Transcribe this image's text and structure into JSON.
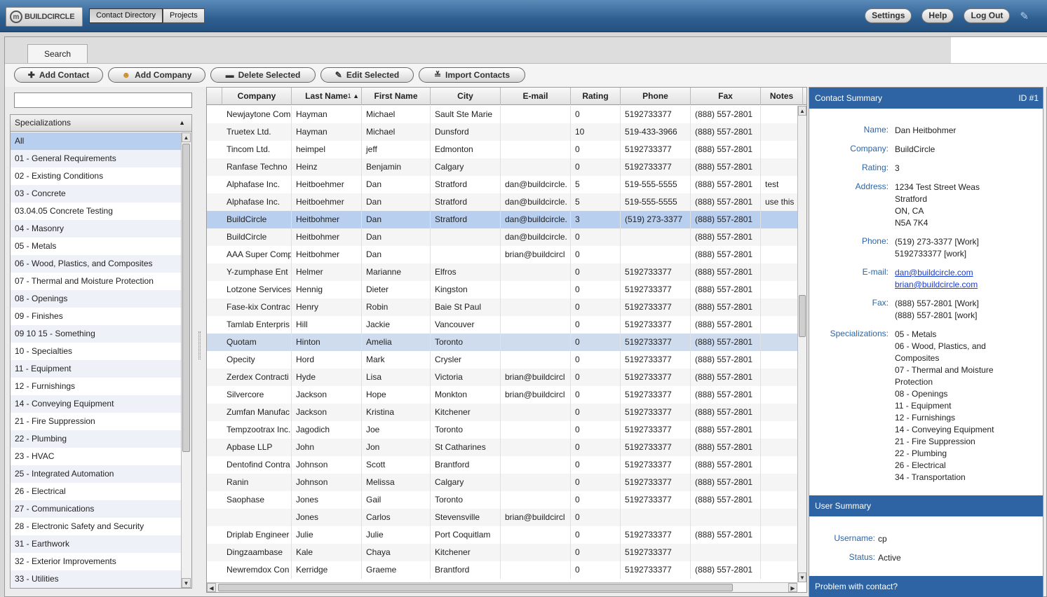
{
  "app": {
    "logo_text": "BUILDCIRCLE"
  },
  "nav": {
    "tabs": [
      "Contact Directory",
      "Projects"
    ],
    "right_buttons": [
      "Settings",
      "Help",
      "Log Out"
    ]
  },
  "search_tab": "Search",
  "toolbar": {
    "add_contact": "Add Contact",
    "add_company": "Add Company",
    "delete_selected": "Delete Selected",
    "edit_selected": "Edit Selected",
    "import_contacts": "Import Contacts"
  },
  "filter": {
    "search_value": "",
    "header": "Specializations",
    "items": [
      "All",
      "01 - General Requirements",
      "02 - Existing Conditions",
      "03 - Concrete",
      "03.04.05 Concrete Testing",
      "04 - Masonry",
      "05 - Metals",
      "06 - Wood, Plastics, and Composites",
      "07 - Thermal and Moisture Protection",
      "08 - Openings",
      "09 - Finishes",
      "09 10 15 - Something",
      "10 - Specialties",
      "11 - Equipment",
      "12 - Furnishings",
      "14 - Conveying Equipment",
      "21 - Fire Suppression",
      "22 - Plumbing",
      "23 - HVAC",
      "25 - Integrated Automation",
      "26 - Electrical",
      "27 - Communications",
      "28 - Electronic Safety and Security",
      "31 - Earthwork",
      "32 - Exterior Improvements",
      "33 - Utilities"
    ],
    "selected_index": 0
  },
  "grid": {
    "columns": [
      "Company",
      "Last Name",
      "First Name",
      "City",
      "E-mail",
      "Rating",
      "Phone",
      "Fax",
      "Notes"
    ],
    "sort_indicator": "1 ▲",
    "selected_row": 6,
    "highlight_row": 13,
    "rows": [
      [
        "Newjaytone Com",
        "Hayman",
        "Michael",
        "Sault Ste Marie",
        "",
        "0",
        "5192733377",
        "(888) 557-2801",
        ""
      ],
      [
        "Truetex Ltd.",
        "Hayman",
        "Michael",
        "Dunsford",
        "",
        "10",
        "519-433-3966",
        "(888) 557-2801",
        ""
      ],
      [
        "Tincom Ltd.",
        "heimpel",
        "jeff",
        "Edmonton",
        "",
        "0",
        "5192733377",
        "(888) 557-2801",
        ""
      ],
      [
        "Ranfase Techno",
        "Heinz",
        "Benjamin",
        "Calgary",
        "",
        "0",
        "5192733377",
        "(888) 557-2801",
        ""
      ],
      [
        "Alphafase Inc.",
        "Heitboehmer",
        "Dan",
        "Stratford",
        "dan@buildcircle.",
        "5",
        "519-555-5555",
        "(888) 557-2801",
        "test"
      ],
      [
        "Alphafase Inc.",
        "Heitboehmer",
        "Dan",
        "Stratford",
        "dan@buildcircle.",
        "5",
        "519-555-5555",
        "(888) 557-2801",
        "use this"
      ],
      [
        "BuildCircle",
        "Heitbohmer",
        "Dan",
        "Stratford",
        "dan@buildcircle.",
        "3",
        "(519) 273-3377",
        "(888) 557-2801",
        ""
      ],
      [
        "BuildCircle",
        "Heitbohmer",
        "Dan",
        "",
        "dan@buildcircle.",
        "0",
        "",
        "(888) 557-2801",
        ""
      ],
      [
        "AAA Super Comp",
        "Heitbohmer",
        "Dan",
        "",
        "brian@buildcircl",
        "0",
        "",
        "(888) 557-2801",
        ""
      ],
      [
        "Y-zumphase Ent",
        "Helmer",
        "Marianne",
        "Elfros",
        "",
        "0",
        "5192733377",
        "(888) 557-2801",
        ""
      ],
      [
        "Lotzone Services",
        "Hennig",
        "Dieter",
        "Kingston",
        "",
        "0",
        "5192733377",
        "(888) 557-2801",
        ""
      ],
      [
        "Fase-kix Contrac",
        "Henry",
        "Robin",
        "Baie St Paul",
        "",
        "0",
        "5192733377",
        "(888) 557-2801",
        ""
      ],
      [
        "Tamlab Enterpris",
        "Hill",
        "Jackie",
        "Vancouver",
        "",
        "0",
        "5192733377",
        "(888) 557-2801",
        ""
      ],
      [
        "Quotam",
        "Hinton",
        "Amelia",
        "Toronto",
        "",
        "0",
        "5192733377",
        "(888) 557-2801",
        ""
      ],
      [
        "Opecity",
        "Hord",
        "Mark",
        "Crysler",
        "",
        "0",
        "5192733377",
        "(888) 557-2801",
        ""
      ],
      [
        "Zerdex Contracti",
        "Hyde",
        "Lisa",
        "Victoria",
        "brian@buildcircl",
        "0",
        "5192733377",
        "(888) 557-2801",
        ""
      ],
      [
        "Silvercore",
        "Jackson",
        "Hope",
        "Monkton",
        "brian@buildcircl",
        "0",
        "5192733377",
        "(888) 557-2801",
        ""
      ],
      [
        "Zumfan Manufac",
        "Jackson",
        "Kristina",
        "Kitchener",
        "",
        "0",
        "5192733377",
        "(888) 557-2801",
        ""
      ],
      [
        "Tempzootrax Inc.",
        "Jagodich",
        "Joe",
        "Toronto",
        "",
        "0",
        "5192733377",
        "(888) 557-2801",
        ""
      ],
      [
        "Apbase LLP",
        "John",
        "Jon",
        "St Catharines",
        "",
        "0",
        "5192733377",
        "(888) 557-2801",
        ""
      ],
      [
        "Dentofind Contra",
        "Johnson",
        "Scott",
        "Brantford",
        "",
        "0",
        "5192733377",
        "(888) 557-2801",
        ""
      ],
      [
        "Ranin",
        "Johnson",
        "Melissa",
        "Calgary",
        "",
        "0",
        "5192733377",
        "(888) 557-2801",
        ""
      ],
      [
        "Saophase",
        "Jones",
        "Gail",
        "Toronto",
        "",
        "0",
        "5192733377",
        "(888) 557-2801",
        ""
      ],
      [
        "",
        "Jones",
        "Carlos",
        "Stevensville",
        "brian@buildcircl",
        "0",
        "",
        "",
        ""
      ],
      [
        "Driplab Engineer",
        "Julie",
        "Julie",
        "Port Coquitlam",
        "",
        "0",
        "5192733377",
        "(888) 557-2801",
        ""
      ],
      [
        "Dingzaambase",
        "Kale",
        "Chaya",
        "Kitchener",
        "",
        "0",
        "5192733377",
        "",
        ""
      ],
      [
        "Newremdox Con",
        "Kerridge",
        "Graeme",
        "Brantford",
        "",
        "0",
        "5192733377",
        "(888) 557-2801",
        ""
      ]
    ]
  },
  "contact_summary": {
    "title": "Contact Summary",
    "id_label": "ID #1",
    "labels": {
      "name": "Name:",
      "company": "Company:",
      "rating": "Rating:",
      "address": "Address:",
      "phone": "Phone:",
      "email": "E-mail:",
      "fax": "Fax:",
      "specializations": "Specializations:"
    },
    "name": "Dan Heitbohmer",
    "company": "BuildCircle",
    "rating": "3",
    "address": [
      "1234 Test Street Weas",
      "Stratford",
      "ON, CA",
      "N5A 7K4"
    ],
    "phones": [
      "(519) 273-3377 [Work]",
      "5192733377 [work]"
    ],
    "emails": [
      "dan@buildcircle.com",
      "brian@buildcircle.com"
    ],
    "faxes": [
      "(888) 557-2801 [Work]",
      "(888) 557-2801 [work]"
    ],
    "specializations": [
      "05 - Metals",
      "06 - Wood, Plastics, and",
      "Composites",
      "07 - Thermal and Moisture",
      "Protection",
      "08 - Openings",
      "11 - Equipment",
      "12 - Furnishings",
      "14 - Conveying Equipment",
      "21 - Fire Suppression",
      "22 - Plumbing",
      "26 - Electrical",
      "34 - Transportation"
    ]
  },
  "user_summary": {
    "title": "User Summary",
    "username_label": "Username:",
    "username": "cp",
    "status_label": "Status:",
    "status": "Active"
  },
  "problem_section": {
    "title": "Problem with contact?"
  }
}
